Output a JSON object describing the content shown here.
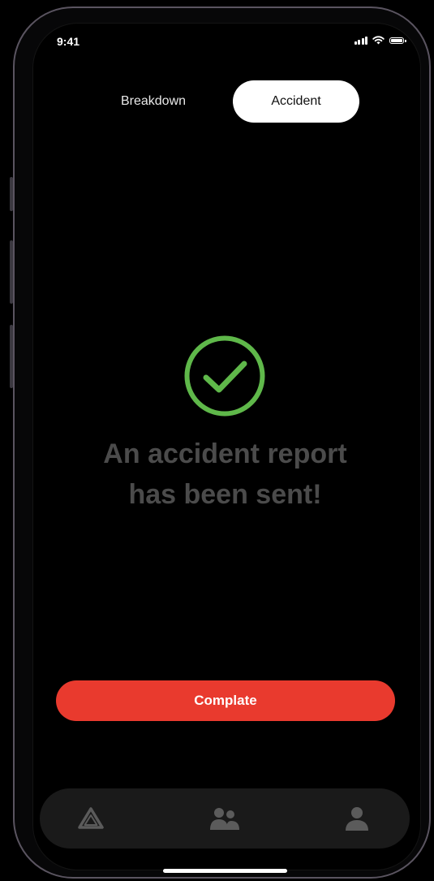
{
  "status_bar": {
    "time": "9:41"
  },
  "tabs": [
    {
      "label": "Breakdown",
      "selected": false
    },
    {
      "label": "Accident",
      "selected": true
    }
  ],
  "confirmation": {
    "icon": "check-circle-icon",
    "message_line1": "An accident report",
    "message_line2": "has been sent!",
    "icon_color": "#5fb84a"
  },
  "actions": {
    "complete_label": "Complate",
    "complete_color": "#e93a2e"
  },
  "bottom_nav": {
    "items": [
      {
        "icon": "triangle-icon",
        "name": "home"
      },
      {
        "icon": "group-icon",
        "name": "group"
      },
      {
        "icon": "profile-icon",
        "name": "profile"
      }
    ]
  }
}
